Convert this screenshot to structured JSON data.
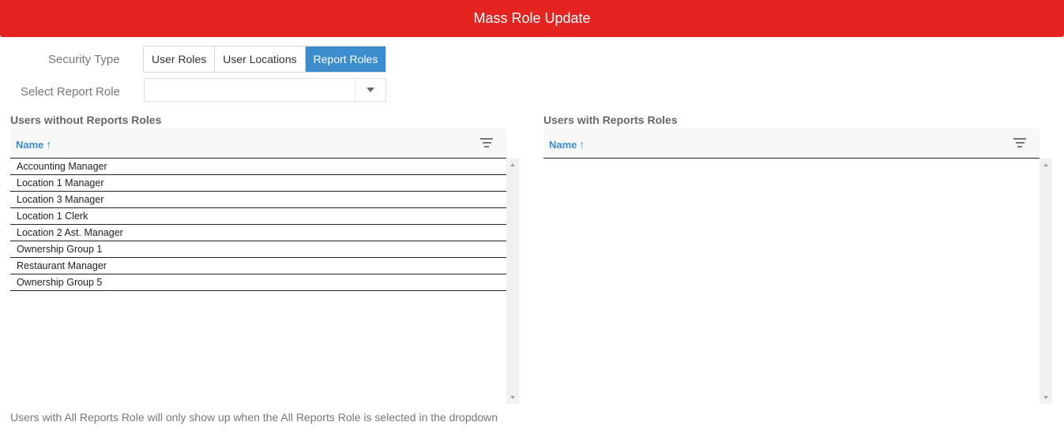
{
  "header": {
    "title": "Mass Role Update"
  },
  "form": {
    "security_type_label": "Security Type",
    "security_types": [
      "User Roles",
      "User Locations",
      "Report Roles"
    ],
    "active_security_type": "Report Roles",
    "select_label": "Select Report Role",
    "select_value": ""
  },
  "left_panel": {
    "title": "Users without Reports Roles",
    "column": "Name",
    "sort_arrow": "↑",
    "rows": [
      "Accounting Manager",
      "Location 1 Manager",
      "Location 3 Manager",
      "Location 1 Clerk",
      "Location 2 Ast. Manager",
      "Ownership Group 1",
      "Restaurant Manager",
      "Ownership Group 5"
    ]
  },
  "right_panel": {
    "title": "Users with Reports Roles",
    "column": "Name",
    "sort_arrow": "↑",
    "rows": []
  },
  "footer": {
    "note": "Users with All Reports Role will only show up when the All Reports Role is selected in the dropdown"
  },
  "colors": {
    "header": "#e52320",
    "accent": "#3c8dcd"
  }
}
